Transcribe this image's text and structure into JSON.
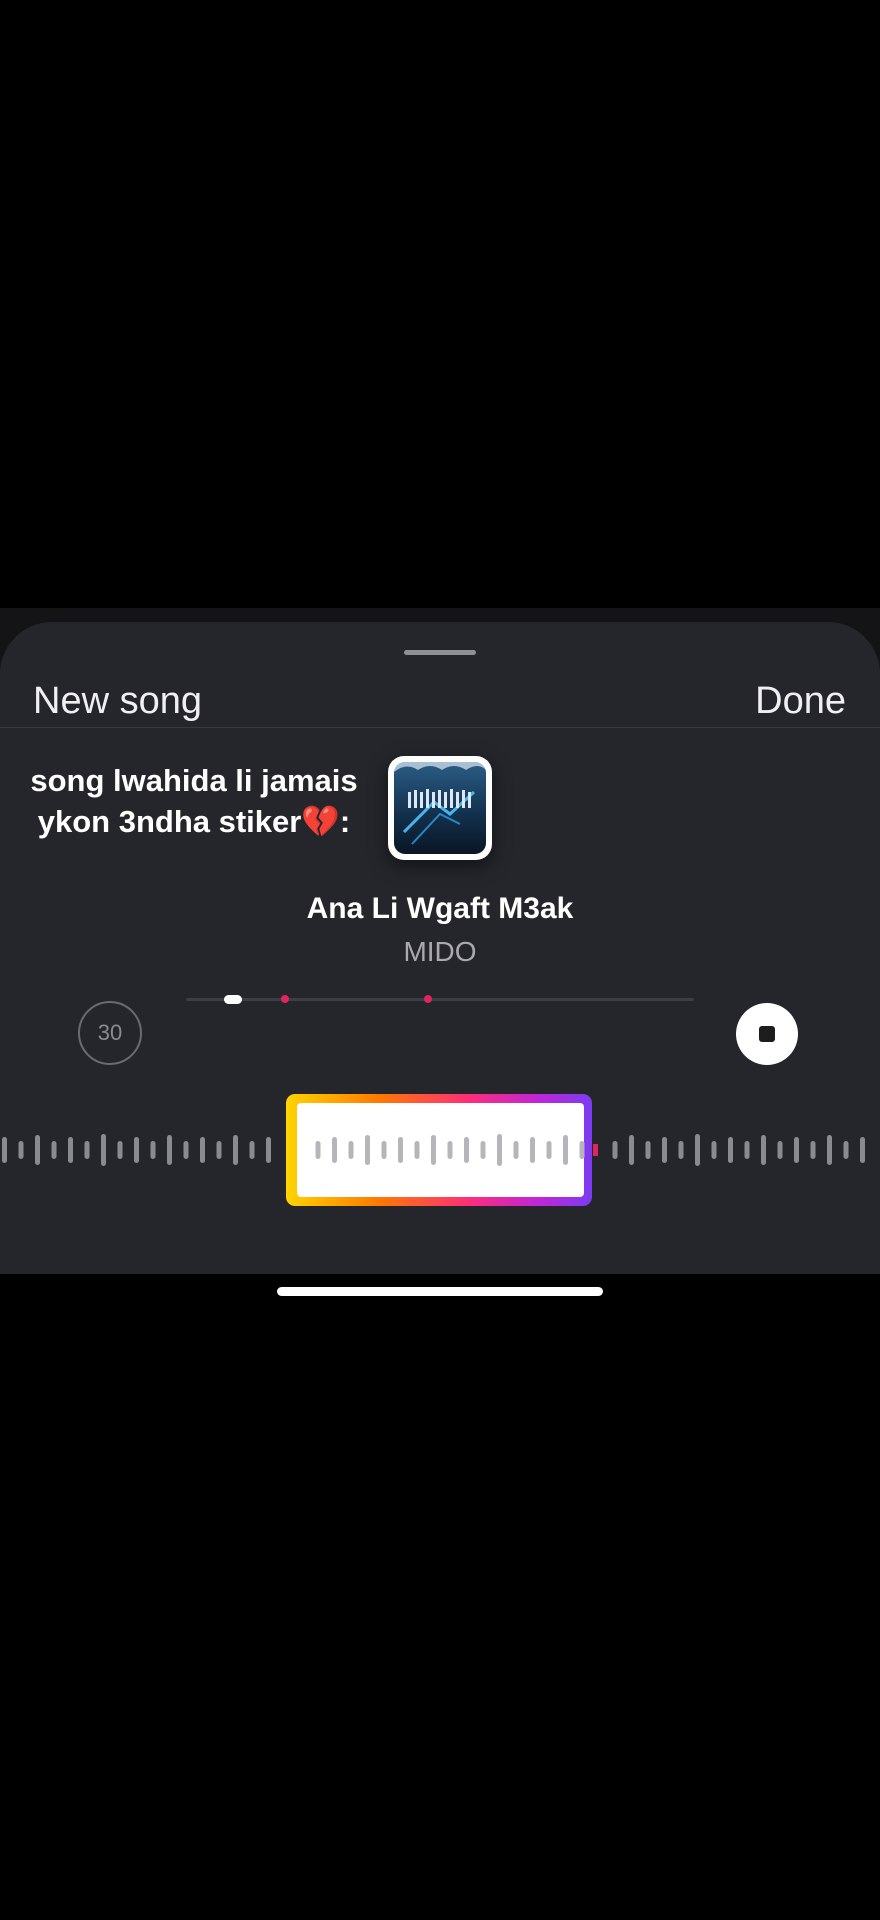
{
  "sheet": {
    "title": "New song",
    "done_label": "Done"
  },
  "overlay_caption": {
    "line1": "song lwahida li jamais",
    "line2": "ykon 3ndha stiker💔:"
  },
  "album": {
    "art_label": "album-cover"
  },
  "track": {
    "title": "Ana Li Wgaft M3ak",
    "artist": "MIDO"
  },
  "player": {
    "clip_duration": "30",
    "stop_icon": "stop-icon",
    "progress_fraction": 0.08
  },
  "colors": {
    "sheet_background": "#25262b",
    "accent_marker": "#e0245e",
    "selection_gradient": [
      "#ffd400",
      "#ff7a00",
      "#ff2d7a",
      "#c126d6",
      "#7b3cf2"
    ]
  }
}
